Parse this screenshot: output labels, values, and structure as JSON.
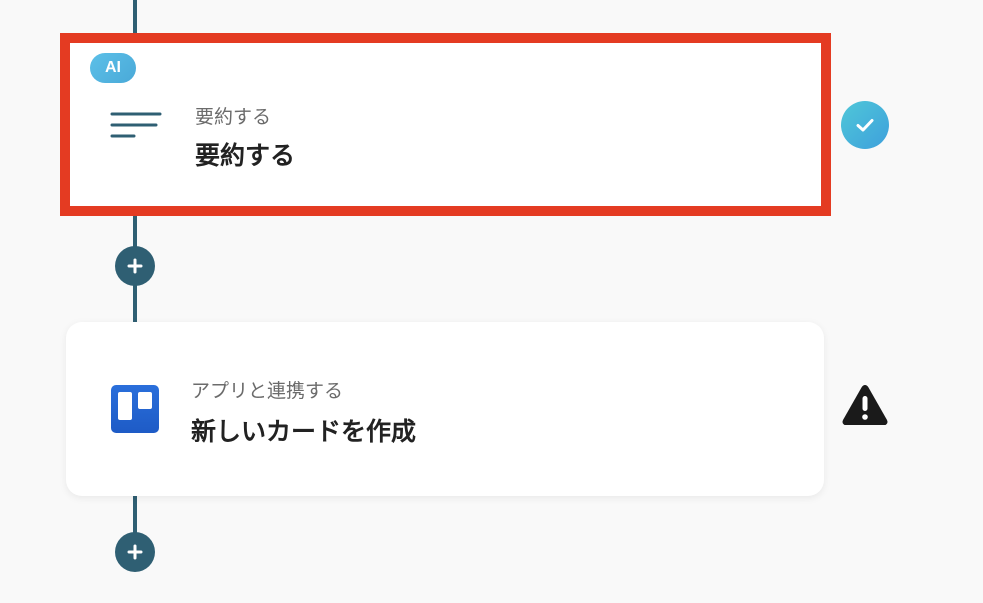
{
  "steps": [
    {
      "badge": "AI",
      "icon": "summarize-lines-icon",
      "subtitle": "要約する",
      "title": "要約する",
      "status": "completed",
      "status_icon": "check-circle-icon"
    },
    {
      "icon": "trello-logo-icon",
      "subtitle": "アプリと連携する",
      "title": "新しいカードを作成",
      "status": "warning",
      "status_icon": "warning-triangle-icon"
    }
  ],
  "add_step_icon": "plus-icon",
  "colors": {
    "connector": "#2f5f73",
    "highlight_border": "#e43b22",
    "ai_badge": "#5cc0e8",
    "trello_blue": "#2a6fdb",
    "success": "#3ea0dc",
    "warning": "#1a1a1a"
  }
}
